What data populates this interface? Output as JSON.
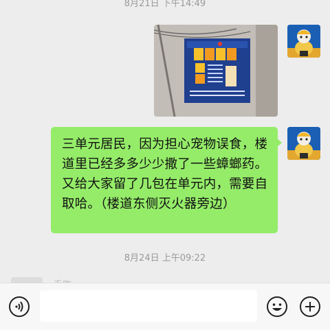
{
  "timestamps": {
    "first": "8月21日 下午14:49",
    "second": "8月24日 上午09:22"
  },
  "messages": [
    {
      "type": "image",
      "sender": "self",
      "poster_lines": [
        "爱护宠物 共建和谐家园",
        "灭鼠除害 人人有责"
      ]
    },
    {
      "type": "text",
      "sender": "self",
      "text": "三单元居民，因为担心宠物误食，楼道里已经多多少少撒了一些蟑螂药。又给大家留了几包在单元内，需要自取哈。（楼道东侧灭火器旁边）"
    }
  ],
  "partial_message_text": "手咋",
  "input": {
    "value": "",
    "placeholder": ""
  },
  "colors": {
    "bubble": "#95ec69",
    "background": "#ededed",
    "avatar_bg": "#1a5fb4"
  },
  "icons": {
    "voice": "voice-icon",
    "emoji": "emoji-icon",
    "more": "plus-icon"
  }
}
